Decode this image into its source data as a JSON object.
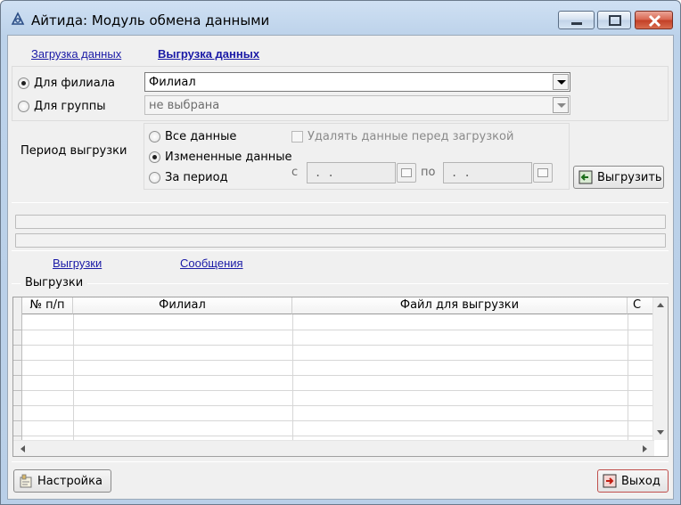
{
  "window": {
    "title": "Айтида: Модуль обмена данными"
  },
  "tabs": {
    "import_label": "Загрузка данных",
    "export_label": "Выгрузка данных"
  },
  "target": {
    "branch_radio": "Для филиала",
    "group_radio": "Для группы",
    "branch_value": "Филиал",
    "group_value": "не выбрана",
    "selected": "branch"
  },
  "period": {
    "label": "Период выгрузки",
    "all_data": "Все данные",
    "changed_data": "Измененные данные",
    "for_period": "За период",
    "selected": "changed_data",
    "delete_checkbox": "Удалять данные перед загрузкой",
    "from_label": "с",
    "to_label": "по",
    "from_value": " .  .",
    "to_value": " .  ."
  },
  "export_button": "Выгрузить",
  "progress": {
    "bar1": 0,
    "bar2": 0
  },
  "lower_tabs": {
    "exports_label": "Выгрузки",
    "messages_label": "Сообщения"
  },
  "exports_group": {
    "title": "Выгрузки",
    "columns": [
      "№ п/п",
      "Филиал",
      "Файл для выгрузки",
      "С"
    ],
    "rows": []
  },
  "footer": {
    "settings_button": "Настройка",
    "exit_button": "Выход"
  },
  "colors": {
    "link": "#1a1aa6",
    "exit_border": "#c0504d"
  }
}
